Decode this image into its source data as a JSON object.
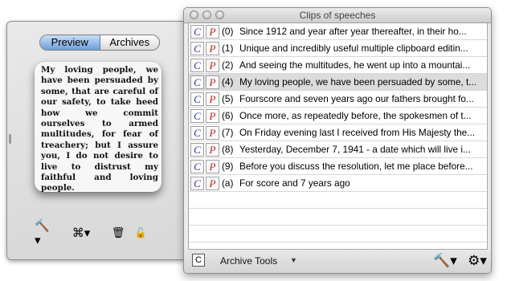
{
  "left_panel": {
    "tabs": [
      {
        "label": "Preview",
        "active": true
      },
      {
        "label": "Archives",
        "active": false
      }
    ],
    "preview_text": "My loving people, we have been persuaded by some, that are careful of our safety, to take heed how we commit ourselves to armed multitudes, for fear of treachery; but I assure you, I do not desire to live to distrust my faithful and loving people.",
    "tools": [
      {
        "icon": "hammer-menu-icon",
        "glyph": "🔨▾"
      },
      {
        "icon": "command-menu-icon",
        "glyph": "⌘▾"
      },
      {
        "icon": "trash-icon",
        "glyph": "🗑"
      },
      {
        "icon": "lock-icon",
        "glyph": "🔓"
      }
    ]
  },
  "window": {
    "title": "Clips of speeches",
    "c_label": "C",
    "p_label": "P",
    "rows": [
      {
        "index": "(0)",
        "text": "Since 1912 and year after year thereafter, in their ho...",
        "selected": false
      },
      {
        "index": "(1)",
        "text": "Unique and incredibly useful multiple clipboard editin...",
        "selected": false
      },
      {
        "index": "(2)",
        "text": "And seeing the multitudes, he went up into a mountai...",
        "selected": false
      },
      {
        "index": "(4)",
        "text": "My loving people, we have been persuaded by some, t...",
        "selected": true
      },
      {
        "index": "(5)",
        "text": "Fourscore and seven years ago our fathers brought fo...",
        "selected": false
      },
      {
        "index": "(6)",
        "text": "Once more, as repeatedly before, the spokesmen of t...",
        "selected": false
      },
      {
        "index": "(7)",
        "text": "On Friday evening last I received from His Majesty the...",
        "selected": false
      },
      {
        "index": "(8)",
        "text": "Yesterday, December 7, 1941 - a date which will live i...",
        "selected": false
      },
      {
        "index": "(9)",
        "text": "Before you discuss the resolution, let me place before...",
        "selected": false
      },
      {
        "index": "(a)",
        "text": "For score and 7 years ago",
        "selected": false
      }
    ],
    "bottom": {
      "c_button": "C",
      "archive_tools_label": "Archive Tools",
      "archive_arrow": "▼",
      "tools": [
        {
          "icon": "hammer-menu-icon",
          "glyph": "🔨▾"
        },
        {
          "icon": "gear-menu-icon",
          "glyph": "⚙▾"
        }
      ]
    }
  }
}
